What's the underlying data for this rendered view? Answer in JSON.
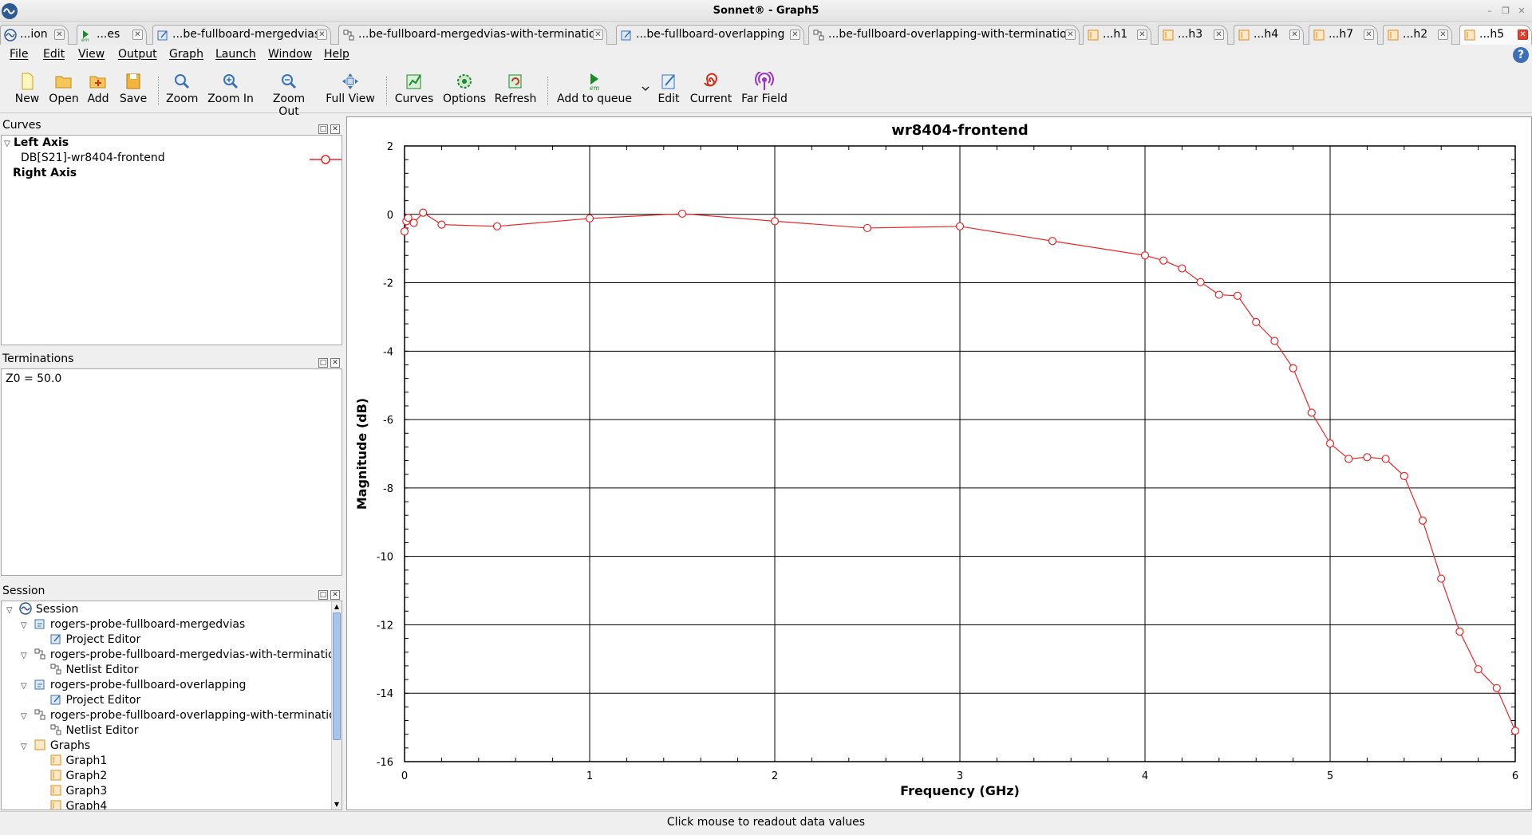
{
  "window": {
    "title": "Sonnet® - Graph5"
  },
  "tabs": [
    {
      "label": "...ion",
      "icon": "sonnet-icon"
    },
    {
      "label": "...es",
      "icon": "em-icon"
    },
    {
      "label": "...be-fullboard-mergedvias",
      "icon": "project-editor-icon"
    },
    {
      "label": "...be-fullboard-mergedvias-with-termination",
      "icon": "netlist-icon"
    },
    {
      "label": "...be-fullboard-overlapping",
      "icon": "project-editor-icon"
    },
    {
      "label": "...be-fullboard-overlapping-with-termination",
      "icon": "netlist-icon"
    },
    {
      "label": "...h1",
      "icon": "graph-icon"
    },
    {
      "label": "...h3",
      "icon": "graph-icon"
    },
    {
      "label": "...h4",
      "icon": "graph-icon"
    },
    {
      "label": "...h7",
      "icon": "graph-icon"
    },
    {
      "label": "...h2",
      "icon": "graph-icon"
    },
    {
      "label": "...h5",
      "icon": "graph-icon",
      "active": true
    }
  ],
  "menu": [
    "File",
    "Edit",
    "View",
    "Output",
    "Graph",
    "Launch",
    "Window",
    "Help"
  ],
  "toolbar": {
    "new": "New",
    "open": "Open",
    "add": "Add",
    "save": "Save",
    "zoom": "Zoom",
    "zoom_in": "Zoom In",
    "zoom_out": "Zoom Out",
    "full_view": "Full View",
    "curves": "Curves",
    "options": "Options",
    "refresh": "Refresh",
    "add_to_queue": "Add to queue",
    "edit": "Edit",
    "current": "Current",
    "far_field": "Far Field"
  },
  "curves_panel": {
    "title": "Curves",
    "left_axis": "Left Axis",
    "curve_name": "DB[S21]-wr8404-frontend",
    "right_axis": "Right Axis"
  },
  "terminations_panel": {
    "title": "Terminations",
    "value": "Z0 = 50.0"
  },
  "session_panel": {
    "title": "Session",
    "root": "Session",
    "items": [
      {
        "label": "rogers-probe-fullboard-mergedvias",
        "child": "Project Editor"
      },
      {
        "label": "rogers-probe-fullboard-mergedvias-with-termination",
        "child": "Netlist Editor"
      },
      {
        "label": "rogers-probe-fullboard-overlapping",
        "child": "Project Editor"
      },
      {
        "label": "rogers-probe-fullboard-overlapping-with-termination",
        "child": "Netlist Editor"
      }
    ],
    "graphs_label": "Graphs",
    "graphs": [
      "Graph1",
      "Graph2",
      "Graph3",
      "Graph4"
    ]
  },
  "status": "Click mouse to readout data values",
  "colors": {
    "curve": "#e8262a",
    "em_green": "#1a8a2a"
  },
  "chart_data": {
    "type": "line",
    "title": "wr8404-frontend",
    "xlabel": "Frequency (GHz)",
    "ylabel": "Magnitude (dB)",
    "xlim": [
      0,
      6
    ],
    "ylim": [
      -16,
      2
    ],
    "xticks": [
      "0",
      "1",
      "2",
      "3",
      "4",
      "5",
      "6"
    ],
    "yticks": [
      "2",
      "0",
      "-2",
      "-4",
      "-6",
      "-8",
      "-10",
      "-12",
      "-14",
      "-16"
    ],
    "grid": true,
    "series": [
      {
        "name": "DB[S21]-wr8404-frontend",
        "color": "#e8262a",
        "marker": "circle",
        "x": [
          0,
          0.01,
          0.02,
          0.05,
          0.1,
          0.2,
          0.5,
          1.0,
          1.5,
          2.0,
          2.5,
          3.0,
          3.5,
          4.0,
          4.1,
          4.2,
          4.3,
          4.4,
          4.5,
          4.6,
          4.7,
          4.8,
          4.9,
          5.0,
          5.1,
          5.2,
          5.3,
          5.4,
          5.5,
          5.6,
          5.7,
          5.8,
          5.9,
          6.0
        ],
        "y": [
          -0.5,
          -0.2,
          -0.1,
          -0.25,
          0.05,
          -0.3,
          -0.35,
          -0.12,
          0.02,
          -0.2,
          -0.4,
          -0.35,
          -0.78,
          -1.2,
          -1.35,
          -1.58,
          -1.98,
          -2.35,
          -2.38,
          -3.15,
          -3.7,
          -4.5,
          -5.8,
          -6.7,
          -7.15,
          -7.1,
          -7.15,
          -7.65,
          -8.95,
          -10.65,
          -12.2,
          -13.3,
          -13.85,
          -15.1
        ]
      }
    ]
  }
}
